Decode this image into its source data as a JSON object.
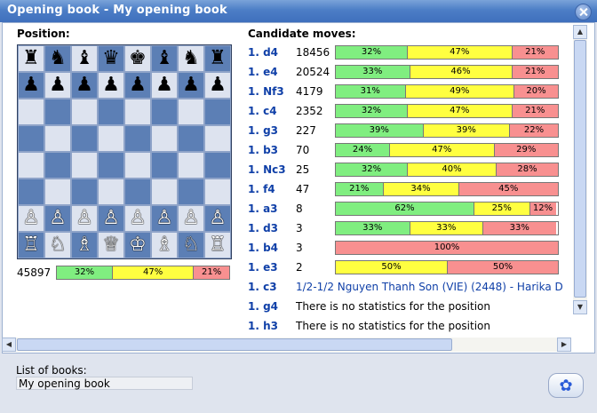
{
  "window": {
    "title": "Opening book - My opening book"
  },
  "position": {
    "heading": "Position:",
    "board": [
      [
        "r",
        "n",
        "b",
        "q",
        "k",
        "b",
        "n",
        "r"
      ],
      [
        "p",
        "p",
        "p",
        "p",
        "p",
        "p",
        "p",
        "p"
      ],
      [
        "",
        "",
        "",
        "",
        "",
        "",
        "",
        ""
      ],
      [
        "",
        "",
        "",
        "",
        "",
        "",
        "",
        ""
      ],
      [
        "",
        "",
        "",
        "",
        "",
        "",
        "",
        ""
      ],
      [
        "",
        "",
        "",
        "",
        "",
        "",
        "",
        ""
      ],
      [
        "P",
        "P",
        "P",
        "P",
        "P",
        "P",
        "P",
        "P"
      ],
      [
        "R",
        "N",
        "B",
        "Q",
        "K",
        "B",
        "N",
        "R"
      ]
    ],
    "total": {
      "count": "45897",
      "white": "32%",
      "draw": "47%",
      "black": "21%",
      "w": 32,
      "d": 47,
      "b": 21
    }
  },
  "candidates": {
    "heading": "Candidate moves:",
    "moves": [
      {
        "move": "1. d4",
        "count": "18456",
        "white": "32%",
        "draw": "47%",
        "black": "21%",
        "w": 32,
        "d": 47,
        "b": 21
      },
      {
        "move": "1. e4",
        "count": "20524",
        "white": "33%",
        "draw": "46%",
        "black": "21%",
        "w": 33,
        "d": 46,
        "b": 21
      },
      {
        "move": "1. Nf3",
        "count": "4179",
        "white": "31%",
        "draw": "49%",
        "black": "20%",
        "w": 31,
        "d": 49,
        "b": 20
      },
      {
        "move": "1. c4",
        "count": "2352",
        "white": "32%",
        "draw": "47%",
        "black": "21%",
        "w": 32,
        "d": 47,
        "b": 21
      },
      {
        "move": "1. g3",
        "count": "227",
        "white": "39%",
        "draw": "39%",
        "black": "22%",
        "w": 39,
        "d": 39,
        "b": 22
      },
      {
        "move": "1. b3",
        "count": "70",
        "white": "24%",
        "draw": "47%",
        "black": "29%",
        "w": 24,
        "d": 47,
        "b": 29
      },
      {
        "move": "1. Nc3",
        "count": "25",
        "white": "32%",
        "draw": "40%",
        "black": "28%",
        "w": 32,
        "d": 40,
        "b": 28
      },
      {
        "move": "1. f4",
        "count": "47",
        "white": "21%",
        "draw": "34%",
        "black": "45%",
        "w": 21,
        "d": 34,
        "b": 45
      },
      {
        "move": "1. a3",
        "count": "8",
        "white": "62%",
        "draw": "25%",
        "black": "12%",
        "w": 62,
        "d": 25,
        "b": 12
      },
      {
        "move": "1. d3",
        "count": "3",
        "white": "33%",
        "draw": "33%",
        "black": "33%",
        "w": 33,
        "d": 33,
        "b": 33
      },
      {
        "move": "1. b4",
        "count": "3",
        "white": "",
        "draw": "",
        "black": "100%",
        "w": 0,
        "d": 0,
        "b": 100
      },
      {
        "move": "1. e3",
        "count": "2",
        "white": "",
        "draw": "50%",
        "black": "50%",
        "w": 0,
        "d": 50,
        "b": 50
      }
    ],
    "others": [
      {
        "move": "1. c3",
        "text": "1/2-1/2 Nguyen Thanh Son (VIE) (2448) - Harika D",
        "link": true
      },
      {
        "move": "1. g4",
        "text": "There is no statistics for the position",
        "link": false
      },
      {
        "move": "1. h3",
        "text": "There is no statistics for the position",
        "link": false
      }
    ]
  },
  "footer": {
    "books_label": "List of books:",
    "selected_book": "My opening book"
  },
  "colors": {
    "white_win": "#80ee80",
    "draw": "#ffff40",
    "black_win": "#f89090",
    "title_bar": "#4c7ec6",
    "move_link": "#1040a8"
  },
  "icons": {
    "close": "close-icon",
    "action": "flower-icon"
  }
}
